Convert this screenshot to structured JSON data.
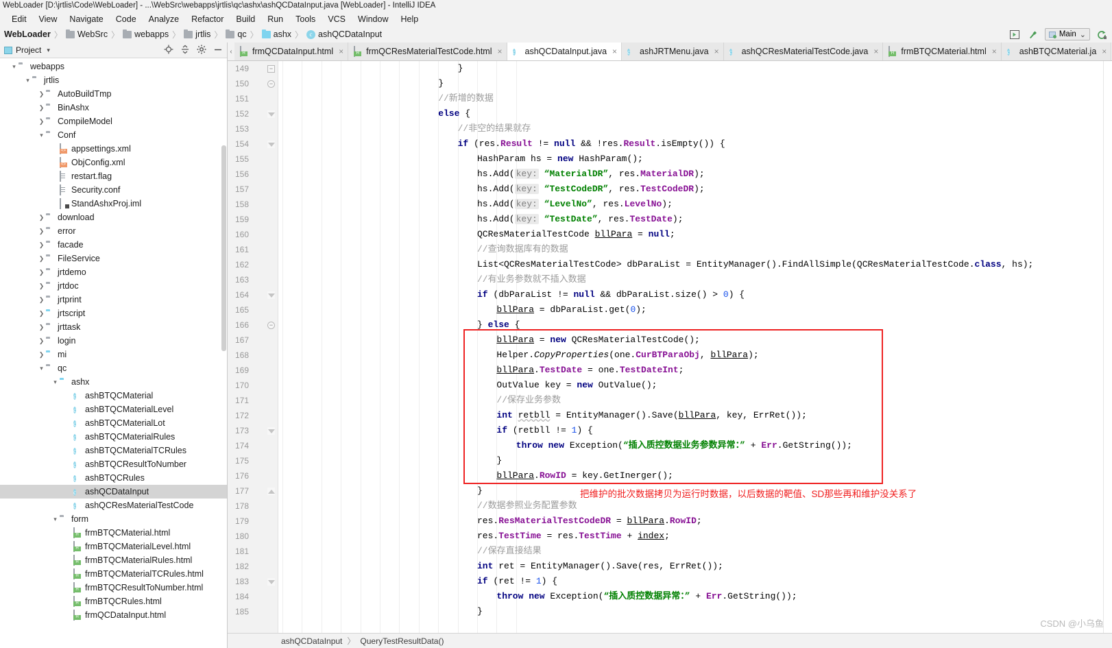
{
  "window": {
    "title": "WebLoader [D:\\jrtlis\\Code\\WebLoader] - ...\\WebSrc\\webapps\\jrtlis\\qc\\ashx\\ashQCDataInput.java [WebLoader] - IntelliJ IDEA"
  },
  "menubar": {
    "items": [
      "Edit",
      "View",
      "Navigate",
      "Code",
      "Analyze",
      "Refactor",
      "Build",
      "Run",
      "Tools",
      "VCS",
      "Window",
      "Help"
    ]
  },
  "breadcrumb": {
    "items": [
      {
        "label": "WebLoader",
        "icon": "none",
        "root": true
      },
      {
        "label": "WebSrc",
        "icon": "folder-gray"
      },
      {
        "label": "webapps",
        "icon": "folder-gray"
      },
      {
        "label": "jrtlis",
        "icon": "folder-gray"
      },
      {
        "label": "qc",
        "icon": "folder-gray"
      },
      {
        "label": "ashx",
        "icon": "folder-blue"
      },
      {
        "label": "ashQCDataInput",
        "icon": "class"
      }
    ],
    "separator": "〉"
  },
  "toolbar_right": {
    "icons": [
      "select-opened-file-icon",
      "hammer-build-icon",
      "rerun-icon"
    ],
    "run_config": {
      "label": "Main",
      "caret": "⌄"
    }
  },
  "project_panel": {
    "title": "Project",
    "caret": "▾",
    "actions": [
      "locate-icon",
      "collapse-all-icon",
      "settings-gear-icon",
      "minimize-icon"
    ],
    "tree": [
      {
        "depth": 1,
        "arrow": "down",
        "icon": "folder-gray",
        "label": "webapps"
      },
      {
        "depth": 2,
        "arrow": "down",
        "icon": "folder-gray",
        "label": "jrtlis"
      },
      {
        "depth": 3,
        "arrow": "right",
        "icon": "folder-gray",
        "label": "AutoBuildTmp"
      },
      {
        "depth": 3,
        "arrow": "right",
        "icon": "folder-gray",
        "label": "BinAshx"
      },
      {
        "depth": 3,
        "arrow": "right",
        "icon": "folder-gray",
        "label": "CompileModel"
      },
      {
        "depth": 3,
        "arrow": "down",
        "icon": "folder-gray",
        "label": "Conf"
      },
      {
        "depth": 4,
        "arrow": "none",
        "icon": "xml",
        "label": "appsettings.xml"
      },
      {
        "depth": 4,
        "arrow": "none",
        "icon": "xml",
        "label": "ObjConfig.xml"
      },
      {
        "depth": 4,
        "arrow": "none",
        "icon": "file",
        "label": "restart.flag"
      },
      {
        "depth": 4,
        "arrow": "none",
        "icon": "file",
        "label": "Security.conf"
      },
      {
        "depth": 4,
        "arrow": "none",
        "icon": "iml",
        "label": "StandAshxProj.iml"
      },
      {
        "depth": 3,
        "arrow": "right",
        "icon": "folder-gray",
        "label": "download"
      },
      {
        "depth": 3,
        "arrow": "right",
        "icon": "folder-gray",
        "label": "error"
      },
      {
        "depth": 3,
        "arrow": "right",
        "icon": "folder-gray",
        "label": "facade"
      },
      {
        "depth": 3,
        "arrow": "right",
        "icon": "folder-gray",
        "label": "FileService"
      },
      {
        "depth": 3,
        "arrow": "right",
        "icon": "folder-gray",
        "label": "jrtdemo"
      },
      {
        "depth": 3,
        "arrow": "right",
        "icon": "folder-gray",
        "label": "jrtdoc"
      },
      {
        "depth": 3,
        "arrow": "right",
        "icon": "folder-gray",
        "label": "jrtprint"
      },
      {
        "depth": 3,
        "arrow": "right",
        "icon": "folder-blue",
        "label": "jrtscript"
      },
      {
        "depth": 3,
        "arrow": "right",
        "icon": "folder-gray",
        "label": "jrttask"
      },
      {
        "depth": 3,
        "arrow": "right",
        "icon": "folder-gray",
        "label": "login"
      },
      {
        "depth": 3,
        "arrow": "right",
        "icon": "folder-blue",
        "label": "mi"
      },
      {
        "depth": 3,
        "arrow": "down",
        "icon": "folder-gray",
        "label": "qc"
      },
      {
        "depth": 4,
        "arrow": "down",
        "icon": "folder-blue",
        "label": "ashx"
      },
      {
        "depth": 5,
        "arrow": "none",
        "icon": "class",
        "label": "ashBTQCMaterial"
      },
      {
        "depth": 5,
        "arrow": "none",
        "icon": "class",
        "label": "ashBTQCMaterialLevel"
      },
      {
        "depth": 5,
        "arrow": "none",
        "icon": "class",
        "label": "ashBTQCMaterialLot"
      },
      {
        "depth": 5,
        "arrow": "none",
        "icon": "class",
        "label": "ashBTQCMaterialRules"
      },
      {
        "depth": 5,
        "arrow": "none",
        "icon": "class",
        "label": "ashBTQCMaterialTCRules"
      },
      {
        "depth": 5,
        "arrow": "none",
        "icon": "class",
        "label": "ashBTQCResultToNumber"
      },
      {
        "depth": 5,
        "arrow": "none",
        "icon": "class",
        "label": "ashBTQCRules"
      },
      {
        "depth": 5,
        "arrow": "none",
        "icon": "class",
        "label": "ashQCDataInput",
        "selected": true
      },
      {
        "depth": 5,
        "arrow": "none",
        "icon": "class",
        "label": "ashQCResMaterialTestCode"
      },
      {
        "depth": 4,
        "arrow": "down",
        "icon": "folder-gray",
        "label": "form"
      },
      {
        "depth": 5,
        "arrow": "none",
        "icon": "html",
        "label": "frmBTQCMaterial.html"
      },
      {
        "depth": 5,
        "arrow": "none",
        "icon": "html",
        "label": "frmBTQCMaterialLevel.html"
      },
      {
        "depth": 5,
        "arrow": "none",
        "icon": "html",
        "label": "frmBTQCMaterialRules.html"
      },
      {
        "depth": 5,
        "arrow": "none",
        "icon": "html",
        "label": "frmBTQCMaterialTCRules.html"
      },
      {
        "depth": 5,
        "arrow": "none",
        "icon": "html",
        "label": "frmBTQCResultToNumber.html"
      },
      {
        "depth": 5,
        "arrow": "none",
        "icon": "html",
        "label": "frmBTQCRules.html"
      },
      {
        "depth": 5,
        "arrow": "none",
        "icon": "html",
        "label": "frmQCDataInput.html"
      }
    ]
  },
  "editor_tabs": [
    {
      "label": "frmQCDataInput.html",
      "icon": "html",
      "active": false,
      "close": "×"
    },
    {
      "label": "frmQCResMaterialTestCode.html",
      "icon": "html",
      "active": false,
      "close": "×"
    },
    {
      "label": "ashQCDataInput.java",
      "icon": "class",
      "active": true,
      "close": "×"
    },
    {
      "label": "ashJRTMenu.java",
      "icon": "class",
      "active": false,
      "close": "×"
    },
    {
      "label": "ashQCResMaterialTestCode.java",
      "icon": "class",
      "active": false,
      "close": "×"
    },
    {
      "label": "frmBTQCMaterial.html",
      "icon": "html",
      "active": false,
      "close": "×"
    },
    {
      "label": "ashBTQCMaterial.ja",
      "icon": "class",
      "active": false,
      "close": "×"
    }
  ],
  "editor": {
    "first_line": 149,
    "last_line": 185,
    "lines": [
      {
        "n": 149,
        "indent": 36,
        "fold": "minus-small",
        "html": "}"
      },
      {
        "n": 150,
        "fold": "minus-round",
        "indent": 32,
        "html": "}"
      },
      {
        "n": 151,
        "indent": 32,
        "html": "<span class=\"cmt\">//新增的数据</span>"
      },
      {
        "n": 152,
        "fold": "tri-down",
        "indent": 32,
        "html": "<span class=\"kw\">else</span> {"
      },
      {
        "n": 153,
        "indent": 36,
        "html": "<span class=\"cmt\">//非空的结果就存</span>"
      },
      {
        "n": 154,
        "fold": "tri-down",
        "indent": 36,
        "html": "<span class=\"kw\">if</span> (res.<span class=\"fld\">Result</span> != <span class=\"kw\">null</span> &amp;&amp; !res.<span class=\"fld\">Result</span>.isEmpty()) {"
      },
      {
        "n": 155,
        "indent": 40,
        "html": "HashParam hs = <span class=\"kw\">new</span> HashParam();"
      },
      {
        "n": 156,
        "indent": 40,
        "html": "hs.Add(<span class=\"param\">key:</span> <span class=\"str\">“MaterialDR”</span>, res.<span class=\"fld\">MaterialDR</span>);"
      },
      {
        "n": 157,
        "indent": 40,
        "html": "hs.Add(<span class=\"param\">key:</span> <span class=\"str\">“TestCodeDR”</span>, res.<span class=\"fld\">TestCodeDR</span>);"
      },
      {
        "n": 158,
        "indent": 40,
        "html": "hs.Add(<span class=\"param\">key:</span> <span class=\"str\">“LevelNo”</span>, res.<span class=\"fld\">LevelNo</span>);"
      },
      {
        "n": 159,
        "indent": 40,
        "html": "hs.Add(<span class=\"param\">key:</span> <span class=\"str\">“TestDate”</span>, res.<span class=\"fld\">TestDate</span>);"
      },
      {
        "n": 160,
        "indent": 40,
        "html": "QCResMaterialTestCode <span class=\"underl\">bllPara</span> = <span class=\"kw\">null</span>;"
      },
      {
        "n": 161,
        "indent": 40,
        "html": "<span class=\"cmt\">//查询数据库有的数据</span>"
      },
      {
        "n": 162,
        "indent": 40,
        "html": "List&lt;QCResMaterialTestCode&gt; dbParaList = EntityManager().FindAllSimple(QCResMaterialTestCode.<span class=\"kw\">class</span>, hs);"
      },
      {
        "n": 163,
        "indent": 40,
        "html": "<span class=\"cmt\">//有业务参数就不插入数据</span>"
      },
      {
        "n": 164,
        "fold": "tri-down",
        "indent": 40,
        "html": "<span class=\"kw\">if</span> (dbParaList != <span class=\"kw\">null</span> &amp;&amp; dbParaList.size() &gt; <span class=\"num\">0</span>) {"
      },
      {
        "n": 165,
        "indent": 44,
        "html": "<span class=\"underl\">bllPara</span> = dbParaList.get(<span class=\"num\">0</span>);"
      },
      {
        "n": 166,
        "fold": "minus-round",
        "indent": 40,
        "html": "} <span class=\"kw\">else</span> {"
      },
      {
        "n": 167,
        "indent": 44,
        "html": "<span class=\"underl\">bllPara</span> = <span class=\"kw\">new</span> QCResMaterialTestCode();"
      },
      {
        "n": 168,
        "indent": 44,
        "html": "Helper.<span class=\"sitm\">CopyProperties</span>(one.<span class=\"fld\">CurBTParaObj</span>, <span class=\"underl\">bllPara</span>);"
      },
      {
        "n": 169,
        "indent": 44,
        "html": "<span class=\"underl\">bllPara</span>.<span class=\"fld\">TestDate</span> = one.<span class=\"fld\">TestDateInt</span>;"
      },
      {
        "n": 170,
        "indent": 44,
        "html": "OutValue key = <span class=\"kw\">new</span> OutValue();"
      },
      {
        "n": 171,
        "indent": 44,
        "html": "<span class=\"cmt\">//保存业务参数</span>"
      },
      {
        "n": 172,
        "indent": 44,
        "html": "<span class=\"kw\">int</span> <span class=\"wavy\">retbll</span> = EntityManager().Save(<span class=\"underl\">bllPara</span>, key, ErrRet());"
      },
      {
        "n": 173,
        "fold": "tri-down",
        "indent": 44,
        "html": "<span class=\"kw\">if</span> (retbll != <span class=\"num\">1</span>) {"
      },
      {
        "n": 174,
        "indent": 48,
        "html": "<span class=\"kw\">throw new</span> Exception(<span class=\"str\">“插入质控数据业务参数异常：”</span> + <span class=\"fld\">Err</span>.GetString());"
      },
      {
        "n": 175,
        "indent": 44,
        "html": "}"
      },
      {
        "n": 176,
        "indent": 44,
        "html": "<span class=\"underl\">bllPara</span>.<span class=\"fld\">RowID</span> = key.GetInerger();"
      },
      {
        "n": 177,
        "fold": "tri-up",
        "indent": 40,
        "html": "}"
      },
      {
        "n": 178,
        "indent": 40,
        "html": "<span class=\"cmt\">//数据参照业务配置参数</span>"
      },
      {
        "n": 179,
        "indent": 40,
        "html": "res.<span class=\"fld\">ResMaterialTestCodeDR</span> = <span class=\"underl\">bllPara</span>.<span class=\"fld\">RowID</span>;"
      },
      {
        "n": 180,
        "indent": 40,
        "html": "res.<span class=\"fld\">TestTime</span> = res.<span class=\"fld\">TestTime</span> + <span class=\"underl\">index</span>;"
      },
      {
        "n": 181,
        "indent": 40,
        "html": "<span class=\"cmt\">//保存直接结果</span>"
      },
      {
        "n": 182,
        "indent": 40,
        "html": "<span class=\"kw\">int</span> ret = EntityManager().Save(res, ErrRet());"
      },
      {
        "n": 183,
        "fold": "tri-down",
        "indent": 40,
        "html": "<span class=\"kw\">if</span> (ret != <span class=\"num\">1</span>) {"
      },
      {
        "n": 184,
        "indent": 44,
        "html": "<span class=\"kw\">throw new</span> Exception(<span class=\"str\">“插入质控数据异常：”</span> + <span class=\"fld\">Err</span>.GetString());"
      },
      {
        "n": 185,
        "indent": 40,
        "html": "}"
      }
    ],
    "annotation": {
      "text": "把维护的批次数据拷贝为运行时数据，以后数据的靶值、SD那些再和维护没关系了",
      "color": "#f01e1e"
    },
    "highlight_box_color": "#ee2222"
  },
  "statusbar": {
    "crumbs": [
      "ashQCDataInput",
      "QueryTestResultData()"
    ],
    "separator": "〉"
  },
  "watermark": {
    "text": "CSDN @小乌鱼"
  }
}
